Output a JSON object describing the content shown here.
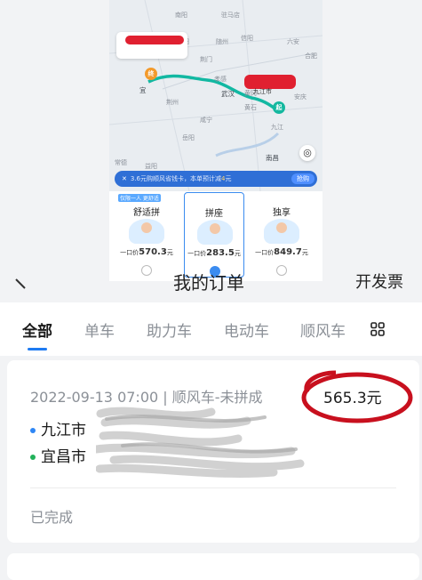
{
  "embedded": {
    "map": {
      "cities": [
        "南阳",
        "驻马店",
        "信阳",
        "荆门",
        "襄阳",
        "随州",
        "孝感",
        "武汉",
        "黄冈",
        "荆州",
        "鄂州",
        "黄石",
        "咸宁",
        "岳阳",
        "南昌",
        "常德",
        "益阳",
        "九江",
        "安庆",
        "合肥",
        "六安",
        "宜",
        "九江市"
      ],
      "start_pin": "终",
      "end_pin": "起"
    },
    "promo": {
      "prefix": "3.6元购顺风省钱卡，本单预计减",
      "amount": "4",
      "suffix": "元",
      "buy_label": "抢购"
    },
    "options": [
      {
        "tag": "仅限一人 更舒适",
        "name": "舒适拼",
        "price_prefix": "一口价",
        "price": "570.3",
        "unit": "元",
        "selected": false
      },
      {
        "tag": "",
        "name": "拼座",
        "price_prefix": "一口价",
        "price": "283.5",
        "unit": "元",
        "selected": true
      },
      {
        "tag": "",
        "name": "独享",
        "price_prefix": "一口价",
        "price": "849.7",
        "unit": "元",
        "selected": false
      }
    ]
  },
  "header": {
    "back_icon": "chevron-left-icon",
    "title": "我的订单",
    "right_action": "开发票"
  },
  "tabs": [
    {
      "label": "全部",
      "active": true
    },
    {
      "label": "单车",
      "active": false
    },
    {
      "label": "助力车",
      "active": false
    },
    {
      "label": "电动车",
      "active": false
    },
    {
      "label": "顺风车",
      "active": false
    }
  ],
  "more_icon": "grid-icon",
  "order": {
    "meta": "2022-09-13 07:00 | 顺风车-未拼成",
    "price": "565.3元",
    "from": "九江市",
    "to": "宜昌市",
    "status": "已完成"
  },
  "colors": {
    "accent": "#1e7bf2",
    "annotation_circle": "#c8101e",
    "from_dot": "#2e86f5",
    "to_dot": "#21b15a"
  }
}
